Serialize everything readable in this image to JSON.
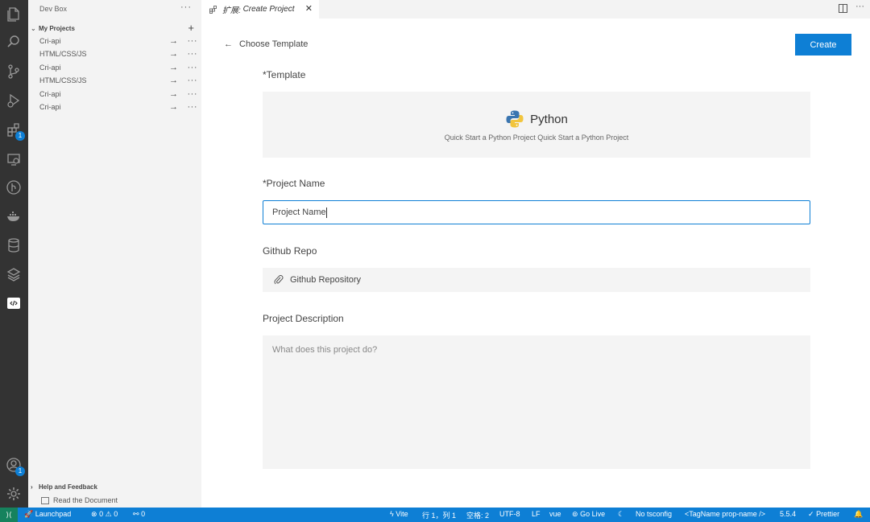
{
  "sidebar": {
    "title": "Dev Box",
    "section_title": "My Projects",
    "projects": [
      {
        "label": "Cri-api"
      },
      {
        "label": "HTML/CSS/JS"
      },
      {
        "label": "Cri-api"
      },
      {
        "label": "HTML/CSS/JS"
      },
      {
        "label": "Cri-api"
      },
      {
        "label": "Cri-api"
      }
    ],
    "help_title": "Help and Feedback",
    "help_item": "Read the Document"
  },
  "activity_bar": {
    "extensions_badge": "1",
    "account_badge": "1"
  },
  "tab": {
    "prefix": "扩展:",
    "title": "Create Project"
  },
  "form": {
    "back_label": "Choose Template",
    "create_label": "Create",
    "template_label": "*Template",
    "template_name": "Python",
    "template_desc": "Quick Start a Python Project Quick Start a Python Project",
    "project_name_label": "*Project Name",
    "project_name_value": "Project Name",
    "github_label": "Github Repo",
    "github_placeholder": "Github Repository",
    "description_label": "Project Description",
    "description_placeholder": "What does this project do?"
  },
  "status": {
    "launchpad": "Launchpad",
    "errors": "0",
    "warnings": "0",
    "ports": "0",
    "vite": "Vite",
    "position": "行 1，列 1",
    "spaces": "空格: 2",
    "encoding": "UTF-8",
    "eol": "LF",
    "language": "vue",
    "golive": "Go Live",
    "tsconfig": "No tsconfig",
    "tagname": "<TagName prop-name />",
    "version": "5.5.4",
    "prettier": "Prettier"
  },
  "colors": {
    "accent": "#0e7fd5",
    "activity_bar": "#333333",
    "sidebar": "#f3f3f3",
    "field_bg": "#f4f4f4"
  }
}
